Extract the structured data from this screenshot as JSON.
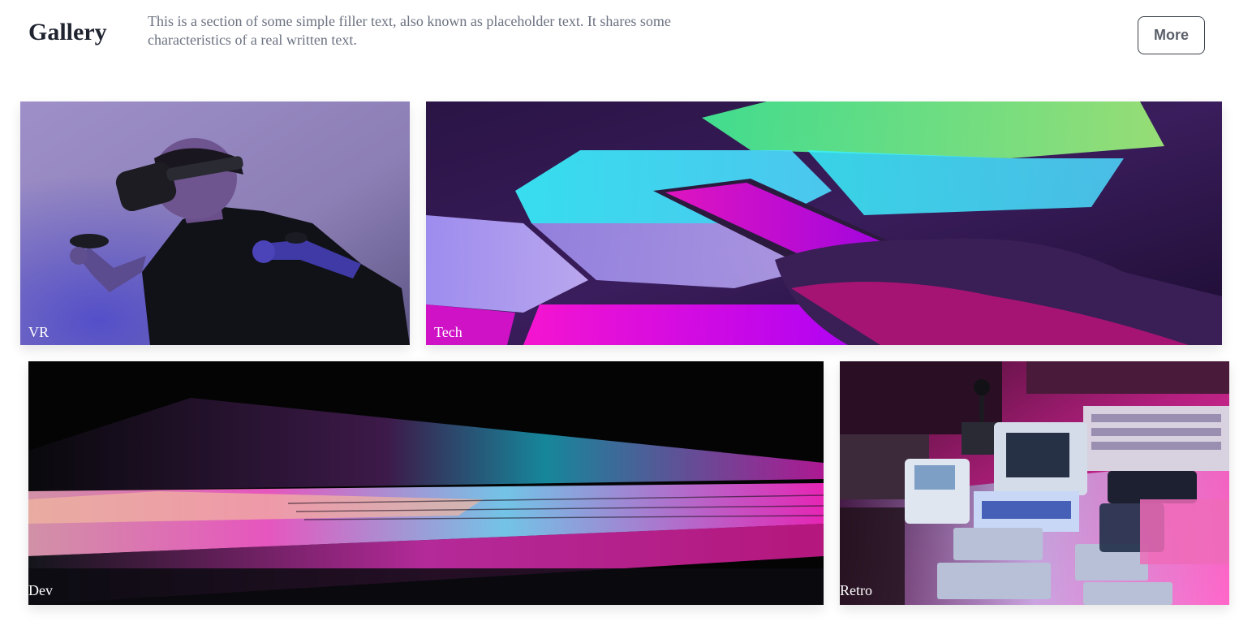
{
  "header": {
    "title": "Gallery",
    "description": "This is a section of some simple filler text, also known as placeholder text. It shares some characteristics of a real written text.",
    "more_label": "More"
  },
  "gallery": {
    "items": [
      {
        "label": "VR"
      },
      {
        "label": "Tech"
      },
      {
        "label": "Dev"
      },
      {
        "label": "Retro"
      }
    ]
  },
  "colors": {
    "title": "#1f2430",
    "description": "#6b7280",
    "button_border": "#3a3f4a",
    "accent_magenta": "#ff1fd1",
    "accent_cyan": "#2ff3e0"
  }
}
